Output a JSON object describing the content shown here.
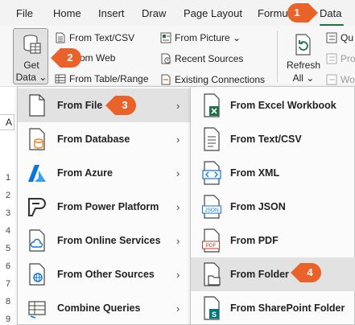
{
  "tabs": [
    {
      "label": "File"
    },
    {
      "label": "Home"
    },
    {
      "label": "Insert"
    },
    {
      "label": "Draw"
    },
    {
      "label": "Page Layout"
    },
    {
      "label": "Formu"
    },
    {
      "label": "Data",
      "active": true
    }
  ],
  "ribbon": {
    "get_data": {
      "line1": "Get",
      "line2": "Data ⌄"
    },
    "get_transform": [
      {
        "label": "From Text/CSV",
        "icon": "text-csv-icon"
      },
      {
        "label": "rom Web",
        "icon": "web-icon"
      },
      {
        "label": "From Table/Range",
        "icon": "table-range-icon"
      }
    ],
    "queries": [
      {
        "label": "From Picture ⌄",
        "icon": "picture-icon"
      },
      {
        "label": "Recent Sources",
        "icon": "recent-sources-icon"
      },
      {
        "label": "Existing Connections",
        "icon": "existing-connections-icon"
      }
    ],
    "refresh": {
      "line1": "Refresh",
      "line2": "All ⌄"
    },
    "right_group": [
      {
        "label": "Qu",
        "icon": "queries-icon"
      },
      {
        "label": "Pro",
        "icon": "properties-icon",
        "disabled": true
      },
      {
        "label": "Wo",
        "icon": "workbook-links-icon",
        "disabled": true
      }
    ]
  },
  "sheet": {
    "name_box_fragment": "A",
    "row_headers": [
      "1",
      "2",
      "3",
      "4",
      "5",
      "6",
      "7",
      "8",
      "9"
    ]
  },
  "get_data_menu": [
    {
      "label": "From File",
      "icon": "file-icon",
      "has_submenu": true,
      "highlighted": true
    },
    {
      "label": "From Database",
      "icon": "database-icon",
      "has_submenu": true
    },
    {
      "label": "From Azure",
      "icon": "azure-icon",
      "has_submenu": true
    },
    {
      "label": "From Power Platform",
      "icon": "power-platform-icon",
      "has_submenu": true
    },
    {
      "label": "From Online Services",
      "icon": "online-services-icon",
      "has_submenu": true
    },
    {
      "label": "From Other Sources",
      "icon": "other-sources-icon",
      "has_submenu": true
    },
    {
      "label": "Combine Queries",
      "icon": "combine-queries-icon",
      "has_submenu": true
    }
  ],
  "from_file_menu": [
    {
      "label": "From Excel Workbook",
      "icon": "excel-workbook-icon"
    },
    {
      "label": "From Text/CSV",
      "icon": "text-file-icon"
    },
    {
      "label": "From XML",
      "icon": "xml-icon"
    },
    {
      "label": "From JSON",
      "icon": "json-icon"
    },
    {
      "label": "From PDF",
      "icon": "pdf-icon"
    },
    {
      "label": "From Folder",
      "icon": "folder-icon",
      "highlighted": true
    },
    {
      "label": "From SharePoint Folder",
      "icon": "sharepoint-folder-icon"
    }
  ],
  "step_badges": [
    "1",
    "2",
    "3",
    "4"
  ],
  "colors": {
    "badge_orange": "#e8622a",
    "excel_green": "#1e7145",
    "azure_blue": "#0a76d8",
    "database_orange": "#e8822a",
    "menu_hover": "#e2e2e2"
  }
}
